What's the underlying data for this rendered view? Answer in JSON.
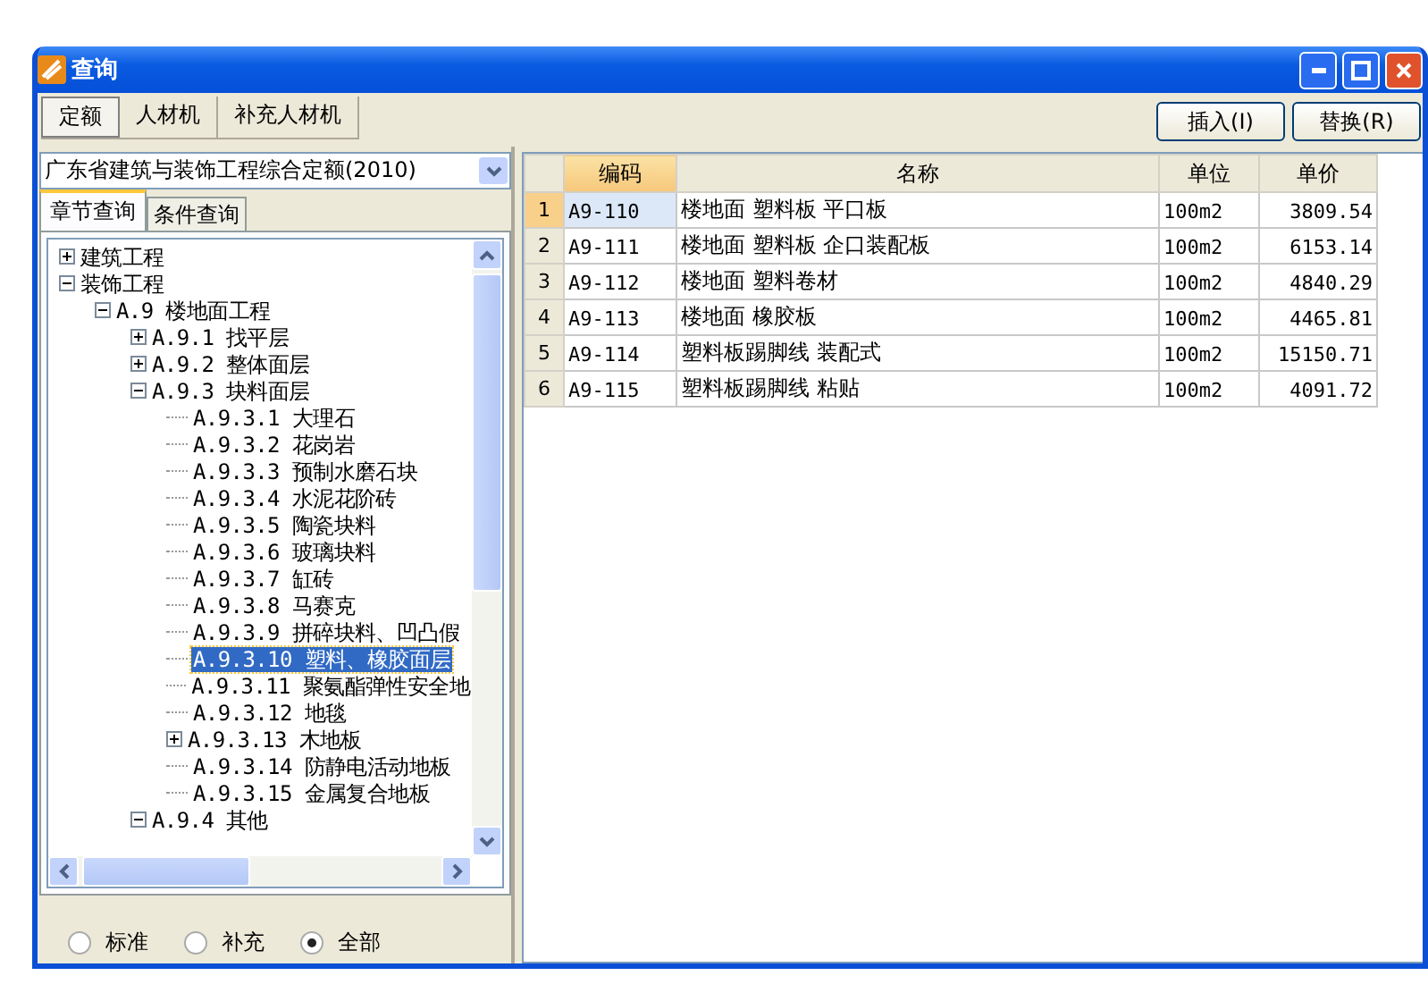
{
  "window": {
    "title": "查询"
  },
  "tabs": [
    {
      "label": "定额",
      "selected": true
    },
    {
      "label": "人材机",
      "selected": false
    },
    {
      "label": "补充人材机",
      "selected": false
    }
  ],
  "buttons": [
    "插入(I)",
    "替换(R)"
  ],
  "library": {
    "value": "广东省建筑与装饰工程综合定额(2010)"
  },
  "query_tabs": [
    {
      "label": "章节查询",
      "selected": true
    },
    {
      "label": "条件查询",
      "selected": false
    }
  ],
  "tree": [
    {
      "label": "建筑工程",
      "kind": "folder",
      "expanded": false,
      "selected": false
    },
    {
      "label": "装饰工程",
      "kind": "folder",
      "expanded": true,
      "selected": false,
      "children": [
        {
          "label": "A.9 楼地面工程",
          "kind": "folder",
          "expanded": true,
          "selected": false,
          "children": [
            {
              "label": "A.9.1 找平层",
              "kind": "folder",
              "expanded": false,
              "selected": false
            },
            {
              "label": "A.9.2 整体面层",
              "kind": "folder",
              "expanded": false,
              "selected": false
            },
            {
              "label": "A.9.3 块料面层",
              "kind": "folder",
              "expanded": true,
              "selected": false,
              "children": [
                {
                  "label": "A.9.3.1 大理石",
                  "kind": "leaf",
                  "selected": false
                },
                {
                  "label": "A.9.3.2 花岗岩",
                  "kind": "leaf",
                  "selected": false
                },
                {
                  "label": "A.9.3.3 预制水磨石块",
                  "kind": "leaf",
                  "selected": false
                },
                {
                  "label": "A.9.3.4 水泥花阶砖",
                  "kind": "leaf",
                  "selected": false
                },
                {
                  "label": "A.9.3.5 陶瓷块料",
                  "kind": "leaf",
                  "selected": false
                },
                {
                  "label": "A.9.3.6 玻璃块料",
                  "kind": "leaf",
                  "selected": false
                },
                {
                  "label": "A.9.3.7 缸砖",
                  "kind": "leaf",
                  "selected": false
                },
                {
                  "label": "A.9.3.8 马赛克",
                  "kind": "leaf",
                  "selected": false
                },
                {
                  "label": "A.9.3.9 拼碎块料、凹凸假",
                  "kind": "leaf",
                  "selected": false
                },
                {
                  "label": "A.9.3.10 塑料、橡胶面层",
                  "kind": "leaf",
                  "selected": true
                },
                {
                  "label": "A.9.3.11 聚氨酯弹性安全地",
                  "kind": "leaf",
                  "selected": false
                },
                {
                  "label": "A.9.3.12 地毯",
                  "kind": "leaf",
                  "selected": false
                },
                {
                  "label": "A.9.3.13 木地板",
                  "kind": "folder",
                  "expanded": false,
                  "selected": false
                },
                {
                  "label": "A.9.3.14 防静电活动地板",
                  "kind": "leaf",
                  "selected": false
                },
                {
                  "label": "A.9.3.15 金属复合地板",
                  "kind": "leaf",
                  "selected": false
                }
              ]
            },
            {
              "label": "A.9.4 其他",
              "kind": "folder",
              "expanded": true,
              "selected": false
            }
          ]
        }
      ]
    }
  ],
  "filter": [
    {
      "label": "标准",
      "selected": false
    },
    {
      "label": "补充",
      "selected": false
    },
    {
      "label": "全部",
      "selected": true
    }
  ],
  "table": {
    "columns": [
      {
        "label": "编码",
        "selected": true
      },
      {
        "label": "名称",
        "selected": false
      },
      {
        "label": "单位",
        "selected": false
      },
      {
        "label": "单价",
        "selected": false
      }
    ],
    "rows": [
      {
        "index": "1",
        "code": "A9-110",
        "name": "楼地面 塑料板 平口板",
        "unit": "100m2",
        "price": "3809.54",
        "selected": true
      },
      {
        "index": "2",
        "code": "A9-111",
        "name": "楼地面 塑料板 企口装配板",
        "unit": "100m2",
        "price": "6153.14",
        "selected": false
      },
      {
        "index": "3",
        "code": "A9-112",
        "name": "楼地面 塑料卷材",
        "unit": "100m2",
        "price": "4840.29",
        "selected": false
      },
      {
        "index": "4",
        "code": "A9-113",
        "name": "楼地面 橡胶板",
        "unit": "100m2",
        "price": "4465.81",
        "selected": false
      },
      {
        "index": "5",
        "code": "A9-114",
        "name": "塑料板踢脚线 装配式",
        "unit": "100m2",
        "price": "15150.71",
        "selected": false
      },
      {
        "index": "6",
        "code": "A9-115",
        "name": "塑料板踢脚线 粘贴",
        "unit": "100m2",
        "price": "4091.72",
        "selected": false
      }
    ]
  }
}
